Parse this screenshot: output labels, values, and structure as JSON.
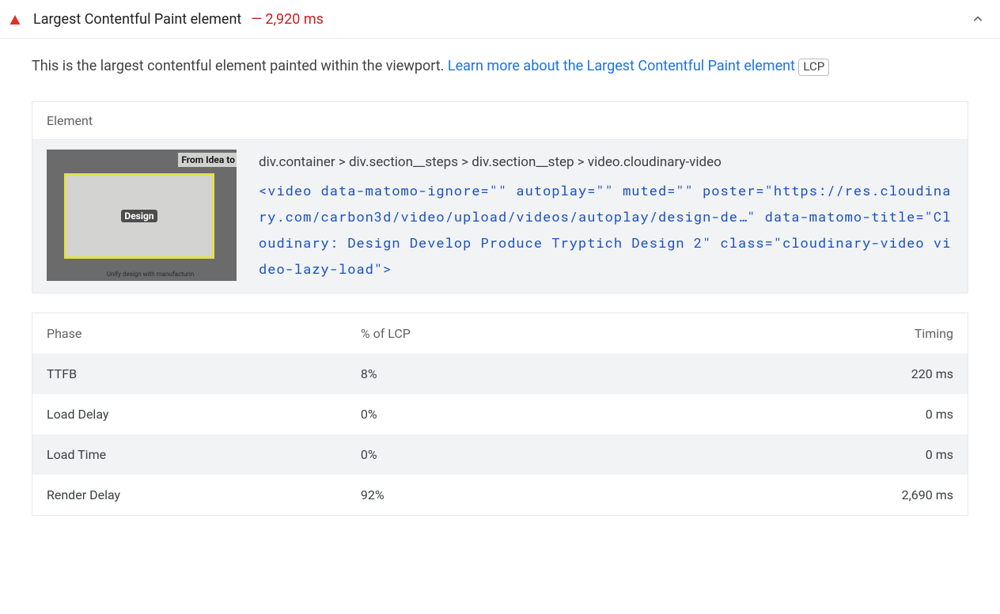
{
  "header": {
    "title": "Largest Contentful Paint element",
    "metric_dash": "—",
    "metric_value": "2,920 ms"
  },
  "description": {
    "prefix": "This is the largest contentful element painted within the viewport. ",
    "link_text": "Learn more about the Largest Contentful Paint element",
    "badge": "LCP"
  },
  "element_panel": {
    "header": "Element",
    "thumb_top": "From Idea to",
    "thumb_center": "Design",
    "thumb_bottom": "Unify design with manufacturin",
    "selector": "div.container > div.section__steps > div.section__step > video.cloudinary-video",
    "html": "<video data-matomo-ignore=\"\" autoplay=\"\" muted=\"\" poster=\"https://res.cloudinary.com/carbon3d/video/upload/videos/autoplay/design-de…\" data-matomo-title=\"Cloudinary: Design Develop Produce Tryptich Design 2\" class=\"cloudinary-video video-lazy-load\">"
  },
  "phase_table": {
    "headers": {
      "phase": "Phase",
      "pct": "% of LCP",
      "timing": "Timing"
    },
    "rows": [
      {
        "phase": "TTFB",
        "pct": "8%",
        "timing": "220 ms"
      },
      {
        "phase": "Load Delay",
        "pct": "0%",
        "timing": "0 ms"
      },
      {
        "phase": "Load Time",
        "pct": "0%",
        "timing": "0 ms"
      },
      {
        "phase": "Render Delay",
        "pct": "92%",
        "timing": "2,690 ms"
      }
    ]
  }
}
